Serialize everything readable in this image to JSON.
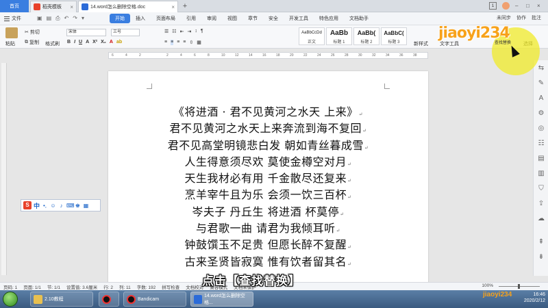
{
  "tabs": {
    "home": "首页",
    "template": "稻壳模板",
    "document": "14.word怎么删除空格.doc",
    "badge": "1"
  },
  "menu": {
    "file": "文件",
    "items": [
      "开始",
      "插入",
      "页面布局",
      "引用",
      "审阅",
      "视图",
      "章节",
      "安全",
      "开发工具",
      "特色应用",
      "文档助手"
    ],
    "sync": "未同步",
    "collab": "协作",
    "comment": "批注"
  },
  "ribbon": {
    "paste": "粘贴",
    "cut": "剪切",
    "copy": "复制",
    "format_painter": "格式刷",
    "font_name": "宋体",
    "font_size": "三号",
    "styles": [
      {
        "sample": "AaBbCcDd",
        "name": "正文"
      },
      {
        "sample": "AaBb",
        "name": "标题 1"
      },
      {
        "sample": "AaBb(",
        "name": "标题 2"
      },
      {
        "sample": "AaBbC(",
        "name": "标题 3"
      }
    ],
    "new_style": "新样式",
    "text_tools": "文字工具",
    "find_replace": "查找替换",
    "select": "选择"
  },
  "ruler_ticks": [
    "6",
    "4",
    "2",
    "",
    "2",
    "4",
    "6",
    "8",
    "10",
    "12",
    "14",
    "16",
    "18",
    "20",
    "22",
    "24",
    "26",
    "28",
    "30",
    "32",
    "34",
    "36",
    "38"
  ],
  "poem": [
    "《将进酒 · 君不见黄河之水天  上来》",
    "君不见黄河之水天上来奔流到海不复回",
    "君不见高堂明镜悲白发  朝如青丝暮成雪",
    "人生得意须尽欢  莫使金樽空对月",
    "天生我材必有用  千金散尽还复来",
    "烹羊宰牛且为乐  会须一饮三百杯",
    "岑夫子  丹丘生  将进酒  杯莫停",
    "与君歌一曲  请君为我倾耳听",
    "钟鼓馔玉不足贵  但愿长醉不复醒",
    "古来圣贤皆寂寞  惟有饮者留其名"
  ],
  "status": {
    "page_no": "页码: 1",
    "pages": "页面: 1/1",
    "section": "节: 1/1",
    "setting": "设置值: 3.6厘米",
    "row": "行: 2",
    "col": "列: 11",
    "words": "字数: 192",
    "spell": "拼写检查",
    "proof": "文档校对",
    "compat": "兼容模式",
    "protect": "文档未保护",
    "zoom": "100%"
  },
  "caption": "点击【查找替换】",
  "taskbar": {
    "items": [
      "2.10教程",
      "Bandicam",
      "14.word怎么删除空格..."
    ],
    "time": "16:46",
    "date": "2020/2/12"
  },
  "watermark": "jiaoyi234",
  "ime": "中",
  "colors": {
    "accent": "#3a7ee0",
    "highlight": "#f0eb28",
    "logo": "#f7a21b"
  }
}
